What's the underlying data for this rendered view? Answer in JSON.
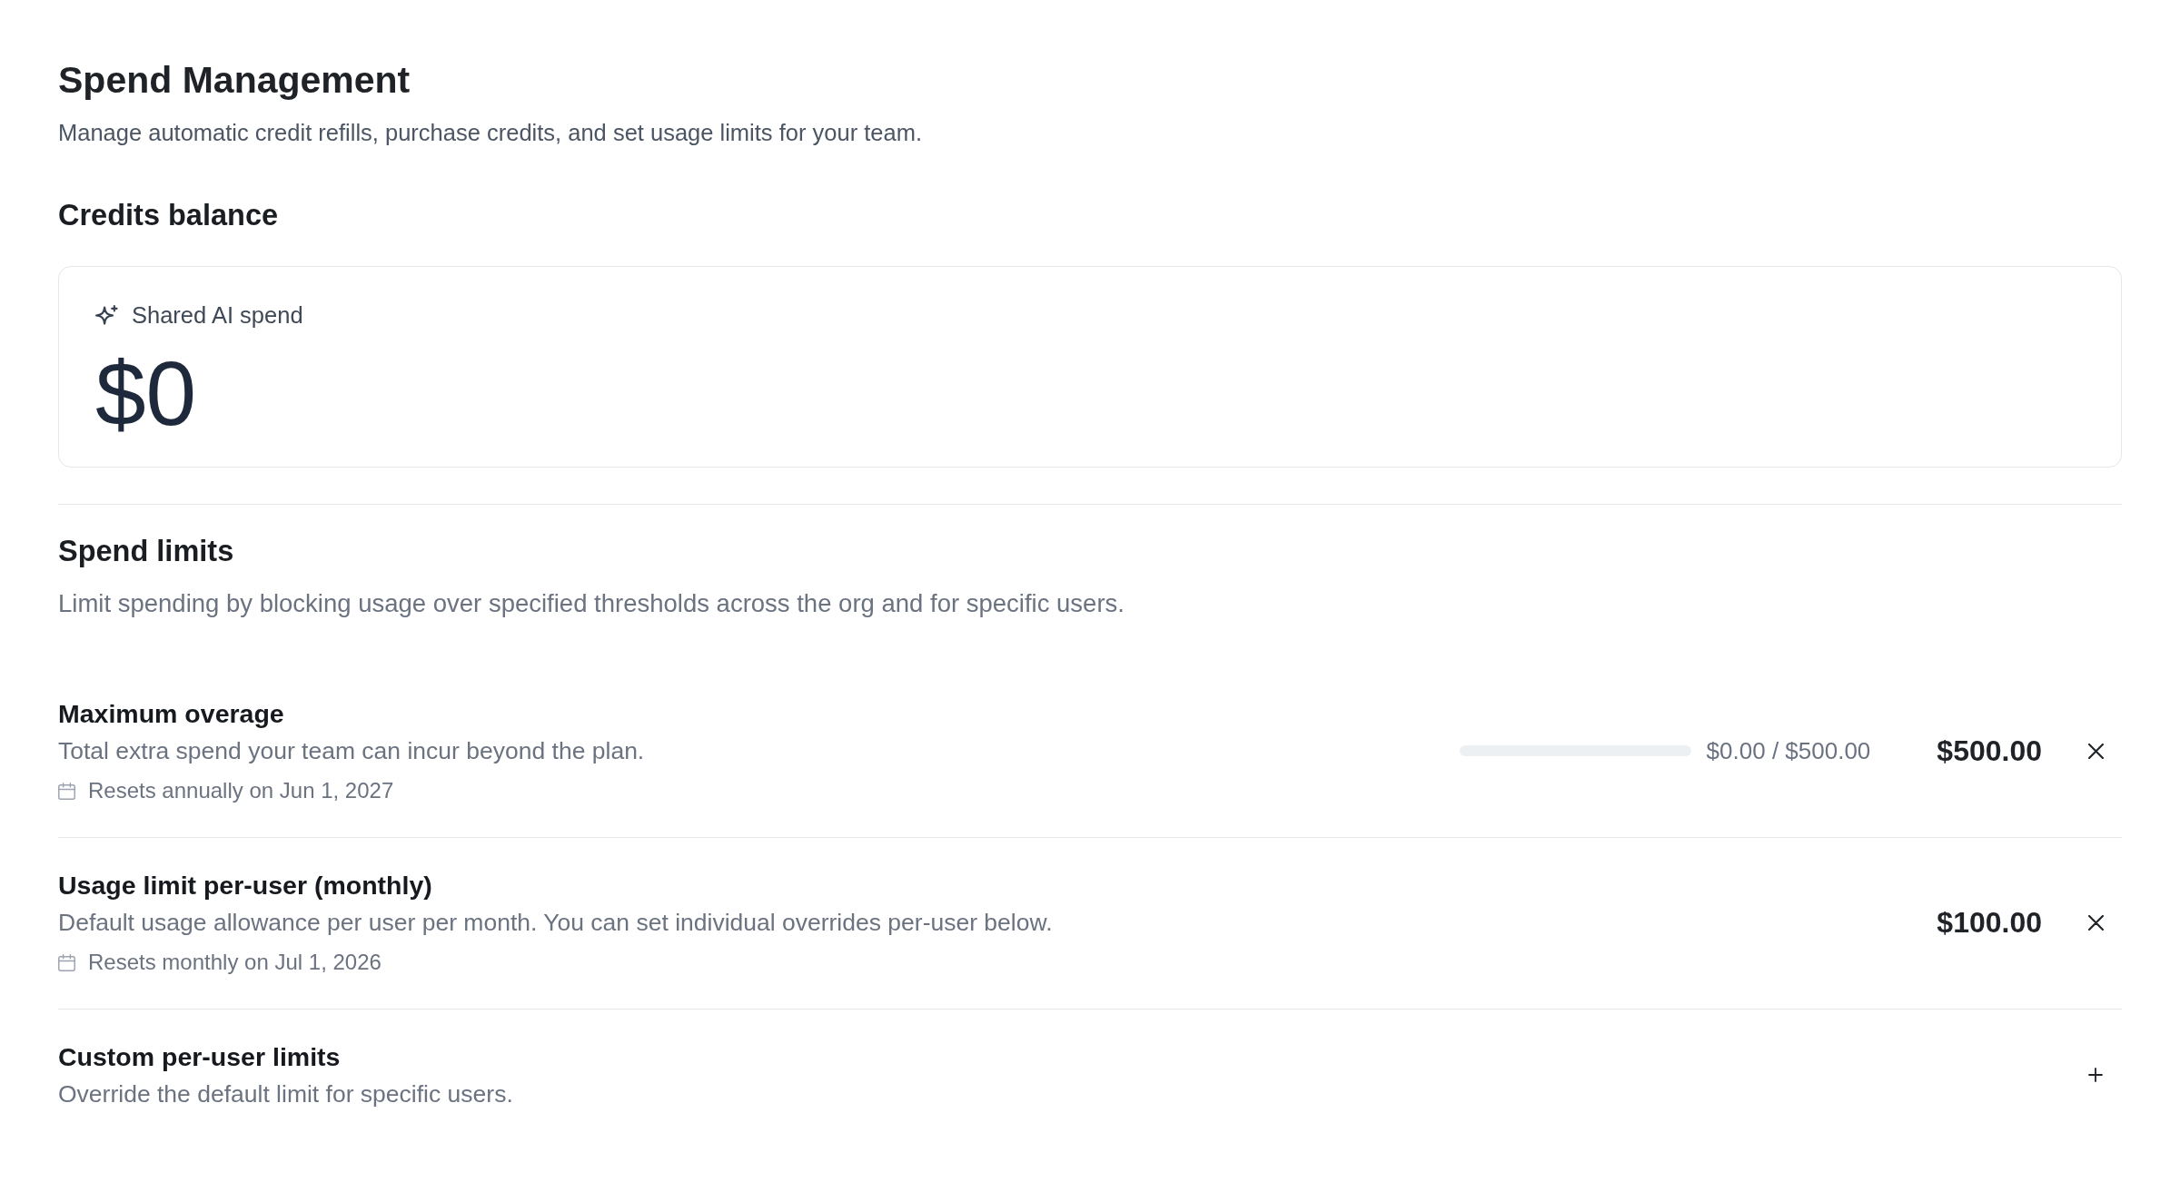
{
  "page": {
    "title": "Spend Management",
    "subtitle": "Manage automatic credit refills, purchase credits, and set usage limits for your team."
  },
  "credits_balance": {
    "heading": "Credits balance",
    "card": {
      "label": "Shared AI spend",
      "amount": "$0"
    }
  },
  "spend_limits": {
    "heading": "Spend limits",
    "description": "Limit spending by blocking usage over specified thresholds across the org and for specific users.",
    "rows": [
      {
        "kind": "meter",
        "title": "Maximum overage",
        "description": "Total extra spend your team can incur beyond the plan.",
        "reset_note": "Resets annually on Jun 1, 2027",
        "level": 0,
        "reading": "$0.00 / $500.00",
        "amount": "$500.00"
      },
      {
        "kind": "limit",
        "title": "Usage limit per-user (monthly)",
        "description": "Default usage allowance per user per month. You can set individual overrides per-user below.",
        "reset_note": "Resets monthly on Jul 1, 2026",
        "amount": "$100.00"
      },
      {
        "kind": "custom",
        "title": "Custom per-user limits",
        "description": "Override the default limit for specific users."
      }
    ]
  }
}
